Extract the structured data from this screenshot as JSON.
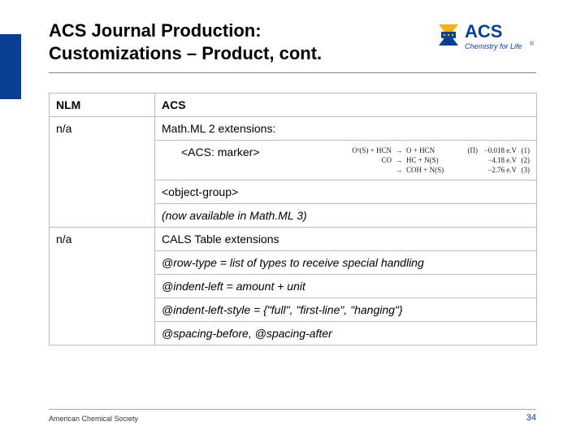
{
  "header": {
    "title_line1": "ACS Journal Production:",
    "title_line2": "Customizations – Product, cont."
  },
  "logo": {
    "brand": "ACS",
    "tagline": "Chemistry for Life"
  },
  "table": {
    "headers": [
      "NLM",
      "ACS"
    ],
    "rows": [
      {
        "left": "n/a",
        "lines": [
          {
            "text": "Math.ML 2 extensions:",
            "indent": false,
            "italic": false
          },
          {
            "text": "<ACS: marker>",
            "indent": true,
            "italic": false
          },
          {
            "text": "<object-group>",
            "indent": true,
            "italic": false
          },
          {
            "text": "(now available in Math.ML 3)",
            "indent": false,
            "italic": true
          }
        ]
      },
      {
        "left": "n/a",
        "lines": [
          {
            "text": "CALS Table extensions",
            "indent": false,
            "italic": false
          },
          {
            "text": "@row-type = list of types to receive special handling",
            "indent": false,
            "italic": true
          },
          {
            "text": "@indent-left = amount + unit",
            "indent": false,
            "italic": true
          },
          {
            "text": "@indent-left-style = {\"full\", \"first-line\", \"hanging\"}",
            "indent": false,
            "italic": true
          },
          {
            "text": "@spacing-before, @spacing-after",
            "indent": false,
            "italic": true
          }
        ]
      }
    ]
  },
  "equations": {
    "rows": [
      {
        "lhs": "O¹(S) + HCN",
        "arrow": "→",
        "rhs": "O + HCN",
        "tag": "(Π)",
        "val": "−0.018 e.V",
        "num": "(1)"
      },
      {
        "lhs": "CO",
        "arrow": "→",
        "rhs": "HC + N(S)",
        "tag": "",
        "val": "−4.18 e.V",
        "num": "(2)"
      },
      {
        "lhs": "",
        "arrow": "→",
        "rhs": "COH + N(S)",
        "tag": "",
        "val": "−2.76 e.V",
        "num": "(3)"
      }
    ]
  },
  "footer": {
    "org": "American Chemical Society",
    "page": "34"
  },
  "colors": {
    "brand_blue": "#0a3f8f",
    "brand_gold": "#f2b01e"
  }
}
